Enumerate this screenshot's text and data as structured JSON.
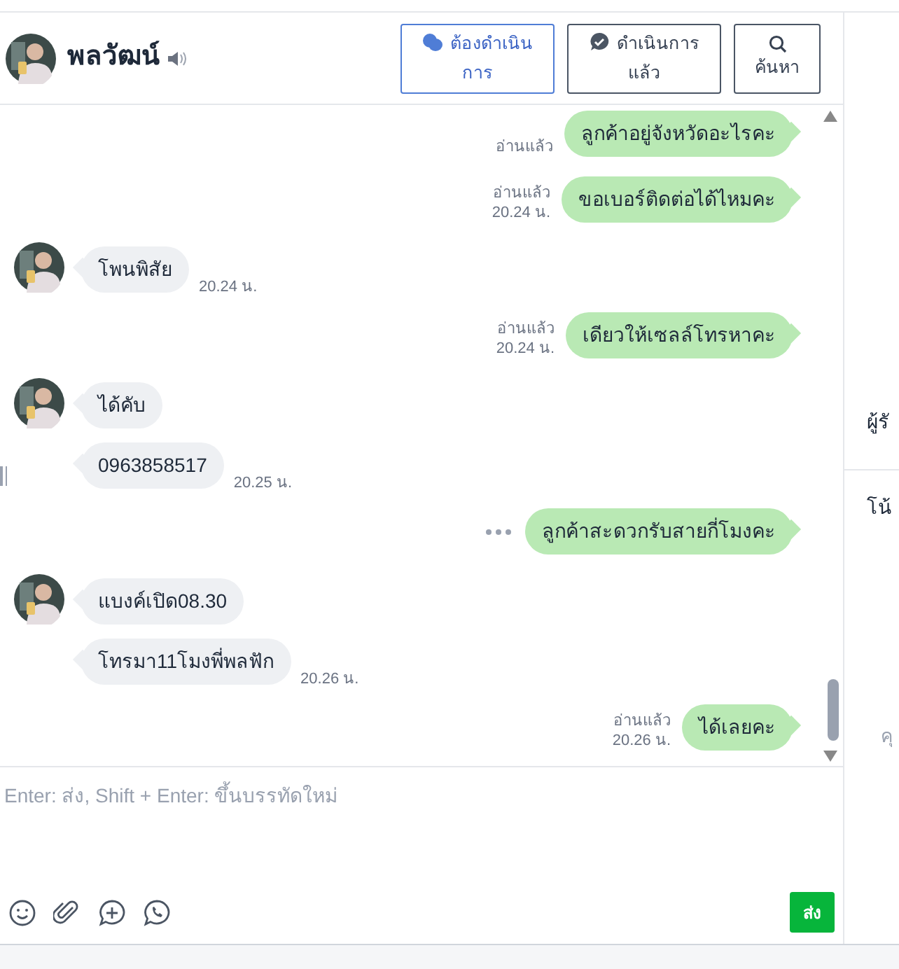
{
  "contact": {
    "name": "พลวัฒน์"
  },
  "header_buttons": [
    {
      "kind": "chat",
      "label": "ต้องดำเนินการ",
      "selected": true
    },
    {
      "kind": "check",
      "label": "ดำเนินการแล้ว",
      "selected": false
    },
    {
      "kind": "search",
      "label": "ค้นหา",
      "selected": false
    }
  ],
  "messages": [
    {
      "kind": "out",
      "text": "ลูกค้าอยู่จังหวัดอะไรคะ",
      "read": "อ่านแล้ว"
    },
    {
      "kind": "out",
      "text": "ขอเบอร์ติดต่อได้ไหมคะ",
      "read": "อ่านแล้ว",
      "time": "20.24 น."
    },
    {
      "kind": "in",
      "avatar": true,
      "text": "โพนพิสัย",
      "time": "20.24 น."
    },
    {
      "kind": "out",
      "text": "เดียวให้เซลล์โทรหาคะ",
      "read": "อ่านแล้ว",
      "time": "20.24 น."
    },
    {
      "kind": "in",
      "avatar": true,
      "text": "ได้คับ"
    },
    {
      "kind": "in",
      "avatar": false,
      "text": "0963858517",
      "time": "20.25 น."
    },
    {
      "kind": "out",
      "text": "ลูกค้าสะดวกรับสายกี่โมงคะ",
      "more": true
    },
    {
      "kind": "in",
      "avatar": true,
      "text": "แบงค์เปิด08.30"
    },
    {
      "kind": "in",
      "avatar": false,
      "text": "โทรมา11โมงพี่พลฟัก",
      "time": "20.26 น."
    },
    {
      "kind": "out",
      "text": "ได้เลยคะ",
      "read": "อ่านแล้ว",
      "time": "20.26 น."
    }
  ],
  "composer": {
    "placeholder": "Enter: ส่ง, Shift + Enter: ขึ้นบรรทัดใหม่",
    "send_label": "ส่ง"
  },
  "side_panel": {
    "label_1": "ผู้รั",
    "label_2": "โน้",
    "hint": "คุ"
  }
}
